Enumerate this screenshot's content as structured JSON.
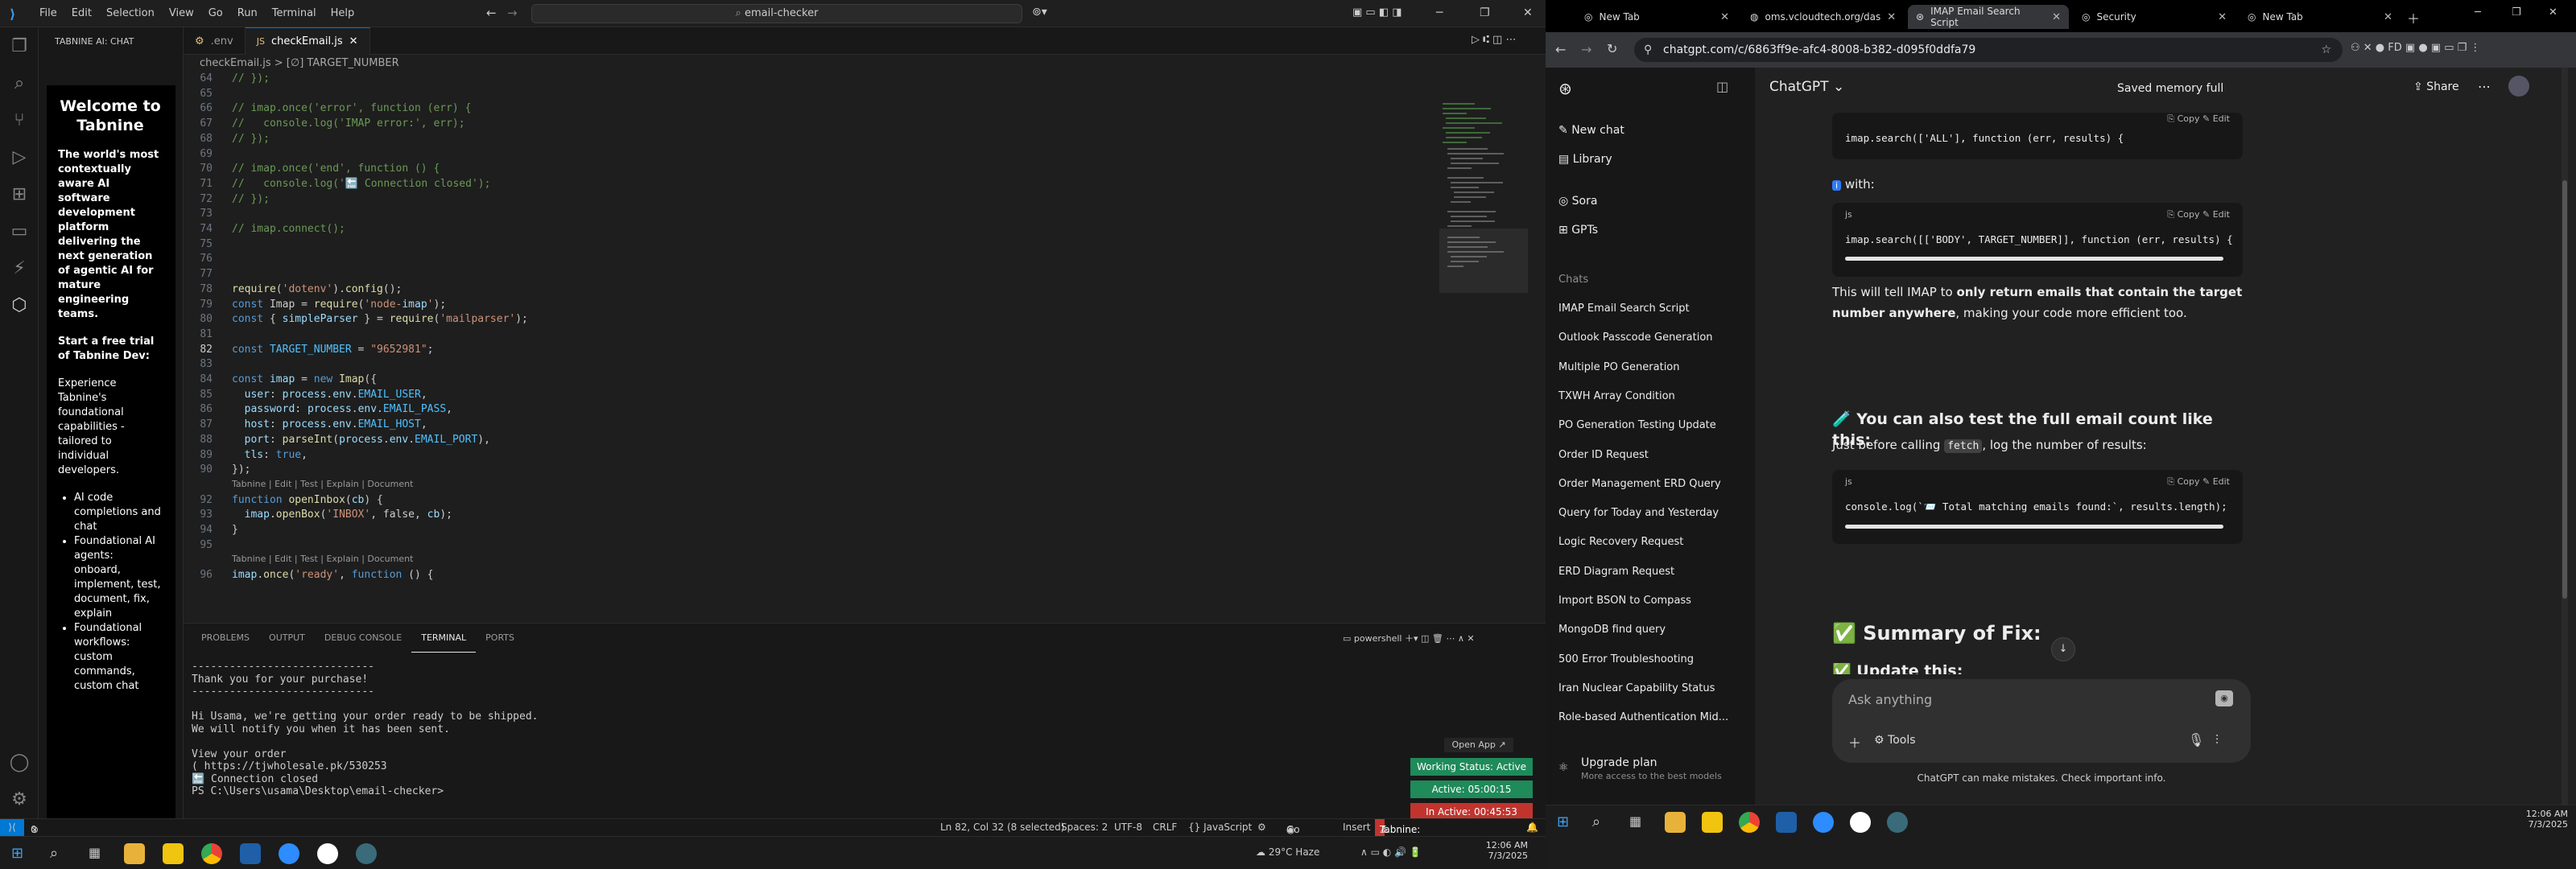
{
  "vscode": {
    "menu": [
      "File",
      "Edit",
      "Selection",
      "View",
      "Go",
      "Run",
      "Terminal",
      "Help"
    ],
    "search_text": "email-checker",
    "sidebar_title": "TABNINE AI: CHAT",
    "tabnine": {
      "welcome": "Welcome to Tabnine",
      "tagline": "The world's most contextually aware AI software development platform delivering the next generation of agentic AI for mature engineering teams.",
      "trial": "Start a free trial of Tabnine Dev:",
      "experience": "Experience Tabnine's foundational capabilities - tailored to individual developers.",
      "bullets": [
        "AI code completions and chat",
        "Foundational AI agents: onboard, implement, test, document, fix, explain",
        "Foundational workflows: custom commands, custom chat"
      ]
    },
    "tabs": [
      ".env",
      "checkEmail.js"
    ],
    "breadcrumb": "checkEmail.js > [∅] TARGET_NUMBER",
    "code_lines": [
      {
        "n": "64",
        "t": "// });",
        "c": "cmt"
      },
      {
        "n": "65",
        "t": "",
        "c": ""
      },
      {
        "n": "66",
        "t": "// imap.once('error', function (err) {",
        "c": "cmt"
      },
      {
        "n": "67",
        "t": "//   console.log('IMAP error:', err);",
        "c": "cmt"
      },
      {
        "n": "68",
        "t": "// });",
        "c": "cmt"
      },
      {
        "n": "69",
        "t": "",
        "c": ""
      },
      {
        "n": "70",
        "t": "// imap.once('end', function () {",
        "c": "cmt"
      },
      {
        "n": "71",
        "t": "//   console.log('🔚 Connection closed');",
        "c": "cmt"
      },
      {
        "n": "72",
        "t": "// });",
        "c": "cmt"
      },
      {
        "n": "73",
        "t": "",
        "c": ""
      },
      {
        "n": "74",
        "t": "// imap.connect();",
        "c": "cmt"
      },
      {
        "n": "75",
        "t": "",
        "c": ""
      },
      {
        "n": "76",
        "t": "",
        "c": ""
      },
      {
        "n": "77",
        "t": "",
        "c": ""
      },
      {
        "n": "78",
        "t": "require('dotenv').config();",
        "c": ""
      },
      {
        "n": "79",
        "t": "const Imap = require('node-imap');",
        "c": ""
      },
      {
        "n": "80",
        "t": "const { simpleParser } = require('mailparser');",
        "c": ""
      },
      {
        "n": "81",
        "t": "",
        "c": ""
      },
      {
        "n": "82",
        "t": "const TARGET_NUMBER = \"9652981\";",
        "c": ""
      },
      {
        "n": "83",
        "t": "",
        "c": ""
      },
      {
        "n": "84",
        "t": "const imap = new Imap({",
        "c": ""
      },
      {
        "n": "85",
        "t": "  user: process.env.EMAIL_USER,",
        "c": ""
      },
      {
        "n": "86",
        "t": "  password: process.env.EMAIL_PASS,",
        "c": ""
      },
      {
        "n": "87",
        "t": "  host: process.env.EMAIL_HOST,",
        "c": ""
      },
      {
        "n": "88",
        "t": "  port: parseInt(process.env.EMAIL_PORT),",
        "c": ""
      },
      {
        "n": "89",
        "t": "  tls: true,",
        "c": ""
      },
      {
        "n": "90",
        "t": "});",
        "c": ""
      },
      {
        "n": "",
        "t": "Tabnine | Edit | Test | Explain | Document",
        "c": "lens"
      },
      {
        "n": "92",
        "t": "function openInbox(cb) {",
        "c": ""
      },
      {
        "n": "93",
        "t": "  imap.openBox('INBOX', false, cb);",
        "c": ""
      },
      {
        "n": "94",
        "t": "}",
        "c": ""
      },
      {
        "n": "95",
        "t": "",
        "c": ""
      },
      {
        "n": "",
        "t": "Tabnine | Edit | Test | Explain | Document",
        "c": "lens"
      },
      {
        "n": "96",
        "t": "imap.once('ready', function () {",
        "c": ""
      }
    ],
    "panel_tabs": [
      "PROBLEMS",
      "OUTPUT",
      "DEBUG CONSOLE",
      "TERMINAL",
      "PORTS"
    ],
    "shell": "powershell",
    "terminal": [
      "-----------------------------",
      "Thank you for your purchase!",
      "-----------------------------",
      "",
      "Hi Usama, we're getting your order ready to be shipped.",
      "We will notify you when it has been sent.",
      "",
      "View your order",
      "( https://tjwholesale.pk/530253",
      "🔚 Connection closed",
      "PS C:\\Users\\usama\\Desktop\\email-checker> "
    ],
    "open_app": "Open App ↗",
    "toasts": {
      "working": "Working Status: Active",
      "active": "Active: 05:00:15",
      "inactive": "In Active: 00:45:53"
    },
    "status": {
      "errors": "0 ⚠ 0",
      "pos": "Ln 82, Col 32 (8 selected)",
      "spaces": "Spaces: 2",
      "enc": "UTF-8",
      "eol": "CRLF",
      "lang": "{} JavaScript",
      "golive": "Go Live",
      "insert": "Insert",
      "tabnine": "Tabnine: Sign in is required"
    },
    "weather": "29°C Haze"
  },
  "chrome": {
    "tabs": [
      "New Tab",
      "oms.vcloudtech.org/das",
      "IMAP Email Search Script",
      "Security",
      "New Tab"
    ],
    "url": "chatgpt.com/c/6863ff9e-afc4-8008-b382-d095f0ddfa79",
    "sidebar": {
      "new_chat": "New chat",
      "library": "Library",
      "sora": "Sora",
      "gpts": "GPTs",
      "chats_label": "Chats",
      "chats": [
        "IMAP Email Search Script",
        "Outlook Passcode Generation",
        "Multiple PO Generation",
        "TXWH Array Condition",
        "PO Generation Testing Update",
        "Order ID Request",
        "Order Management ERD Query",
        "Query for Today and Yesterday",
        "Logic Recovery Request",
        "ERD Diagram Request",
        "Import BSON to Compass",
        "MongoDB find query",
        "500 Error Troubleshooting",
        "Iran Nuclear Capability Status",
        "Role-based Authentication Mid..."
      ],
      "upgrade": "Upgrade plan",
      "upgrade_sub": "More access to the best models"
    },
    "header": {
      "model": "ChatGPT",
      "memory": "Saved memory full",
      "share": "Share"
    },
    "content": {
      "code1": "imap.search(['ALL'], function (err, results) {",
      "with": "with:",
      "code2": "imap.search([['BODY', TARGET_NUMBER]], function (err, results) {",
      "lang": "js",
      "copy": "Copy",
      "edit": "Edit",
      "p1a": "This will tell IMAP to ",
      "p1b": "only return emails that contain the target number anywhere",
      "p1c": ", making your code more efficient too.",
      "h_test": "🧪 You can also test the full email count like this:",
      "p2a": "Just before calling ",
      "p2b": "fetch",
      "p2c": ", log the number of results:",
      "code3": "console.log(`📨 Total matching emails found:`, results.length);",
      "h_summary": "✅ Summary of Fix:",
      "h_update": "✅ Update this:"
    },
    "composer": {
      "placeholder": "Ask anything",
      "tools": "Tools"
    },
    "disclaimer": "ChatGPT can make mistakes. Check important info."
  },
  "clock": {
    "time": "12:06 AM",
    "date": "7/3/2025"
  }
}
